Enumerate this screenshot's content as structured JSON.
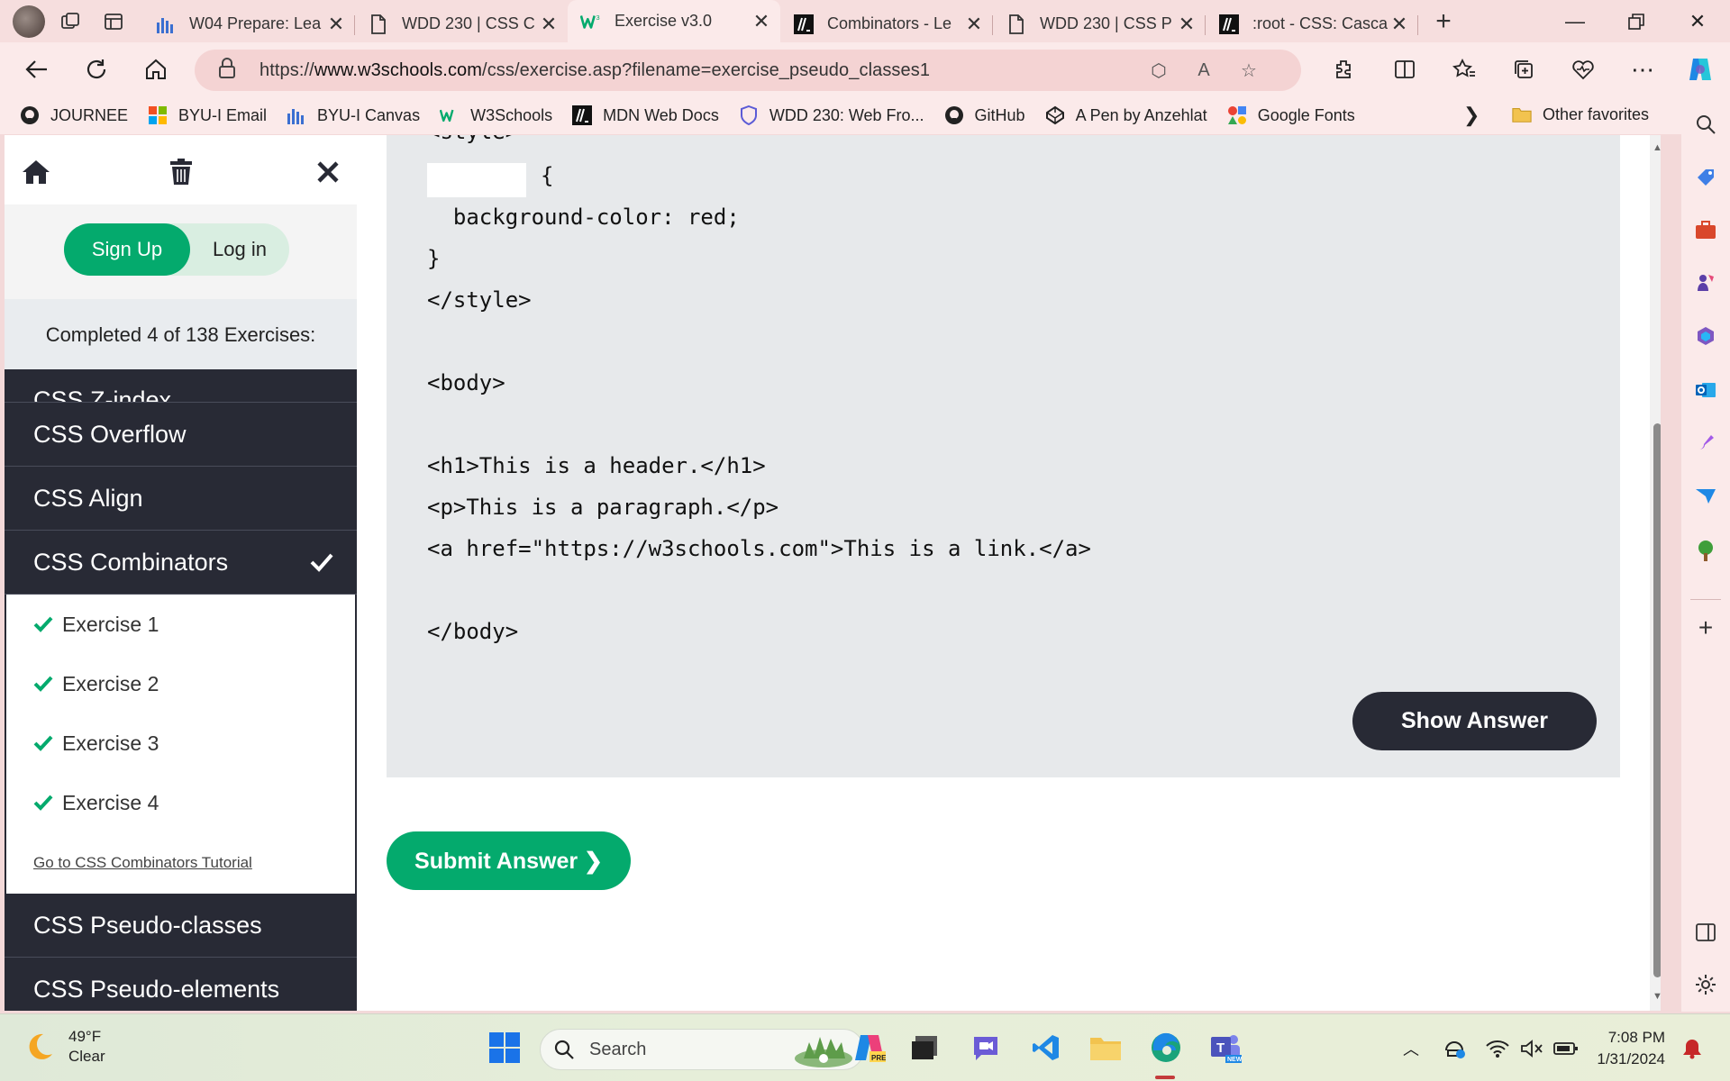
{
  "browser": {
    "tabs": [
      {
        "title": "W04 Prepare: Lea",
        "icon": "canvas-icon"
      },
      {
        "title": "WDD 230 | CSS C",
        "icon": "document-icon"
      },
      {
        "title": "Exercise v3.0",
        "icon": "w3schools-icon"
      },
      {
        "title": "Combinators - Le",
        "icon": "mdn-icon"
      },
      {
        "title": "WDD 230 | CSS P",
        "icon": "document-icon"
      },
      {
        "title": ":root - CSS: Casca",
        "icon": "mdn-icon"
      }
    ],
    "active_tab_index": 2,
    "url_prefix": "https://",
    "url_host": "www.w3schools.com",
    "url_path": "/css/exercise.asp?filename=exercise_pseudo_classes1",
    "favorites": [
      {
        "label": "JOURNEE",
        "icon": "github-icon"
      },
      {
        "label": "BYU-I Email",
        "icon": "microsoft-icon"
      },
      {
        "label": "BYU-I Canvas",
        "icon": "canvas-icon"
      },
      {
        "label": "W3Schools",
        "icon": "w3schools-icon"
      },
      {
        "label": "MDN Web Docs",
        "icon": "mdn-icon"
      },
      {
        "label": "WDD 230: Web Fro...",
        "icon": "shield-icon"
      },
      {
        "label": "GitHub",
        "icon": "github-icon"
      },
      {
        "label": "A Pen by Anzehlat",
        "icon": "codepen-icon"
      },
      {
        "label": "Google Fonts",
        "icon": "google-fonts-icon"
      }
    ],
    "other_favorites": "Other favorites"
  },
  "sidebar": {
    "sign_up": "Sign Up",
    "log_in": "Log in",
    "progress": "Completed 4 of 138 Exercises:",
    "topics_before": [
      "CSS Z-index",
      "CSS Overflow",
      "CSS Align"
    ],
    "current_topic": "CSS Combinators",
    "exercises": [
      "Exercise 1",
      "Exercise 2",
      "Exercise 3",
      "Exercise 4"
    ],
    "tutorial_link": "Go to CSS Combinators Tutorial",
    "topics_after": [
      "CSS Pseudo-classes",
      "CSS Pseudo-elements"
    ]
  },
  "exercise": {
    "code_lines": [
      "<style>",
      "{",
      "  background-color: red;",
      "}",
      "</style>",
      "<body>",
      "<h1>This is a header.</h1>",
      "<p>This is a paragraph.</p>",
      "<a href=\"https://w3schools.com\">This is a link.</a>",
      "</body>"
    ],
    "show_answer": "Show Answer",
    "submit_answer": "Submit Answer ❯"
  },
  "taskbar": {
    "temperature": "49°F",
    "condition": "Clear",
    "search_placeholder": "Search",
    "time": "7:08 PM",
    "date": "1/31/2024"
  },
  "colors": {
    "w3_green": "#04aa6d",
    "w3_dark": "#282a35",
    "code_bg": "#e7e9eb"
  }
}
